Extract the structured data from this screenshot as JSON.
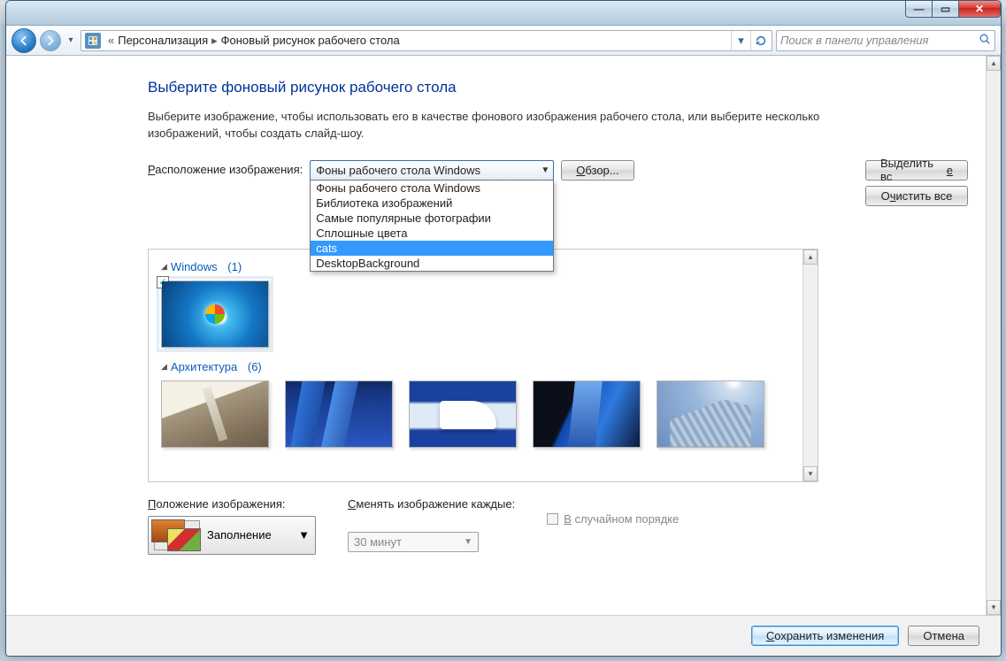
{
  "titlebar": {
    "min": "—",
    "max": "▭",
    "close": "✕"
  },
  "nav": {
    "crumb1": "Персонализация",
    "crumb2": "Фоновый рисунок рабочего стола",
    "search_placeholder": "Поиск в панели управления"
  },
  "page": {
    "title": "Выберите фоновый рисунок рабочего стола",
    "description": "Выберите изображение, чтобы использовать его в качестве фонового изображения рабочего стола, или выберите несколько изображений, чтобы создать слайд-шоу."
  },
  "location": {
    "label_prefix": "Р",
    "label_rest": "асположение изображения:",
    "selected": "Фоны рабочего стола Windows",
    "options": [
      "Фоны рабочего стола Windows",
      "Библиотека изображений",
      "Самые популярные фотографии",
      "Сплошные цвета",
      "cats",
      "DesktopBackground"
    ],
    "highlighted_index": 4,
    "browse_prefix": "О",
    "browse_rest": "бзор..."
  },
  "side_buttons": {
    "select_all_pre": "Выделить вс",
    "select_all_u": "е",
    "clear_all_pre": "О",
    "clear_all_u": "ч",
    "clear_all_post": "истить все"
  },
  "gallery": {
    "cat1_name": "Windows",
    "cat1_count": "(1)",
    "cat2_name": "Архитектура",
    "cat2_count": "(6)"
  },
  "position": {
    "label_prefix": "П",
    "label_rest": "оложение изображения:",
    "value": "Заполнение"
  },
  "interval": {
    "label_prefix": "С",
    "label_rest": "менять изображение каждые:",
    "value": "30 минут"
  },
  "random": {
    "prefix": "В",
    "rest": " случайном порядке"
  },
  "footer": {
    "save_u": "С",
    "save_rest": "охранить изменения",
    "cancel": "Отмена"
  }
}
